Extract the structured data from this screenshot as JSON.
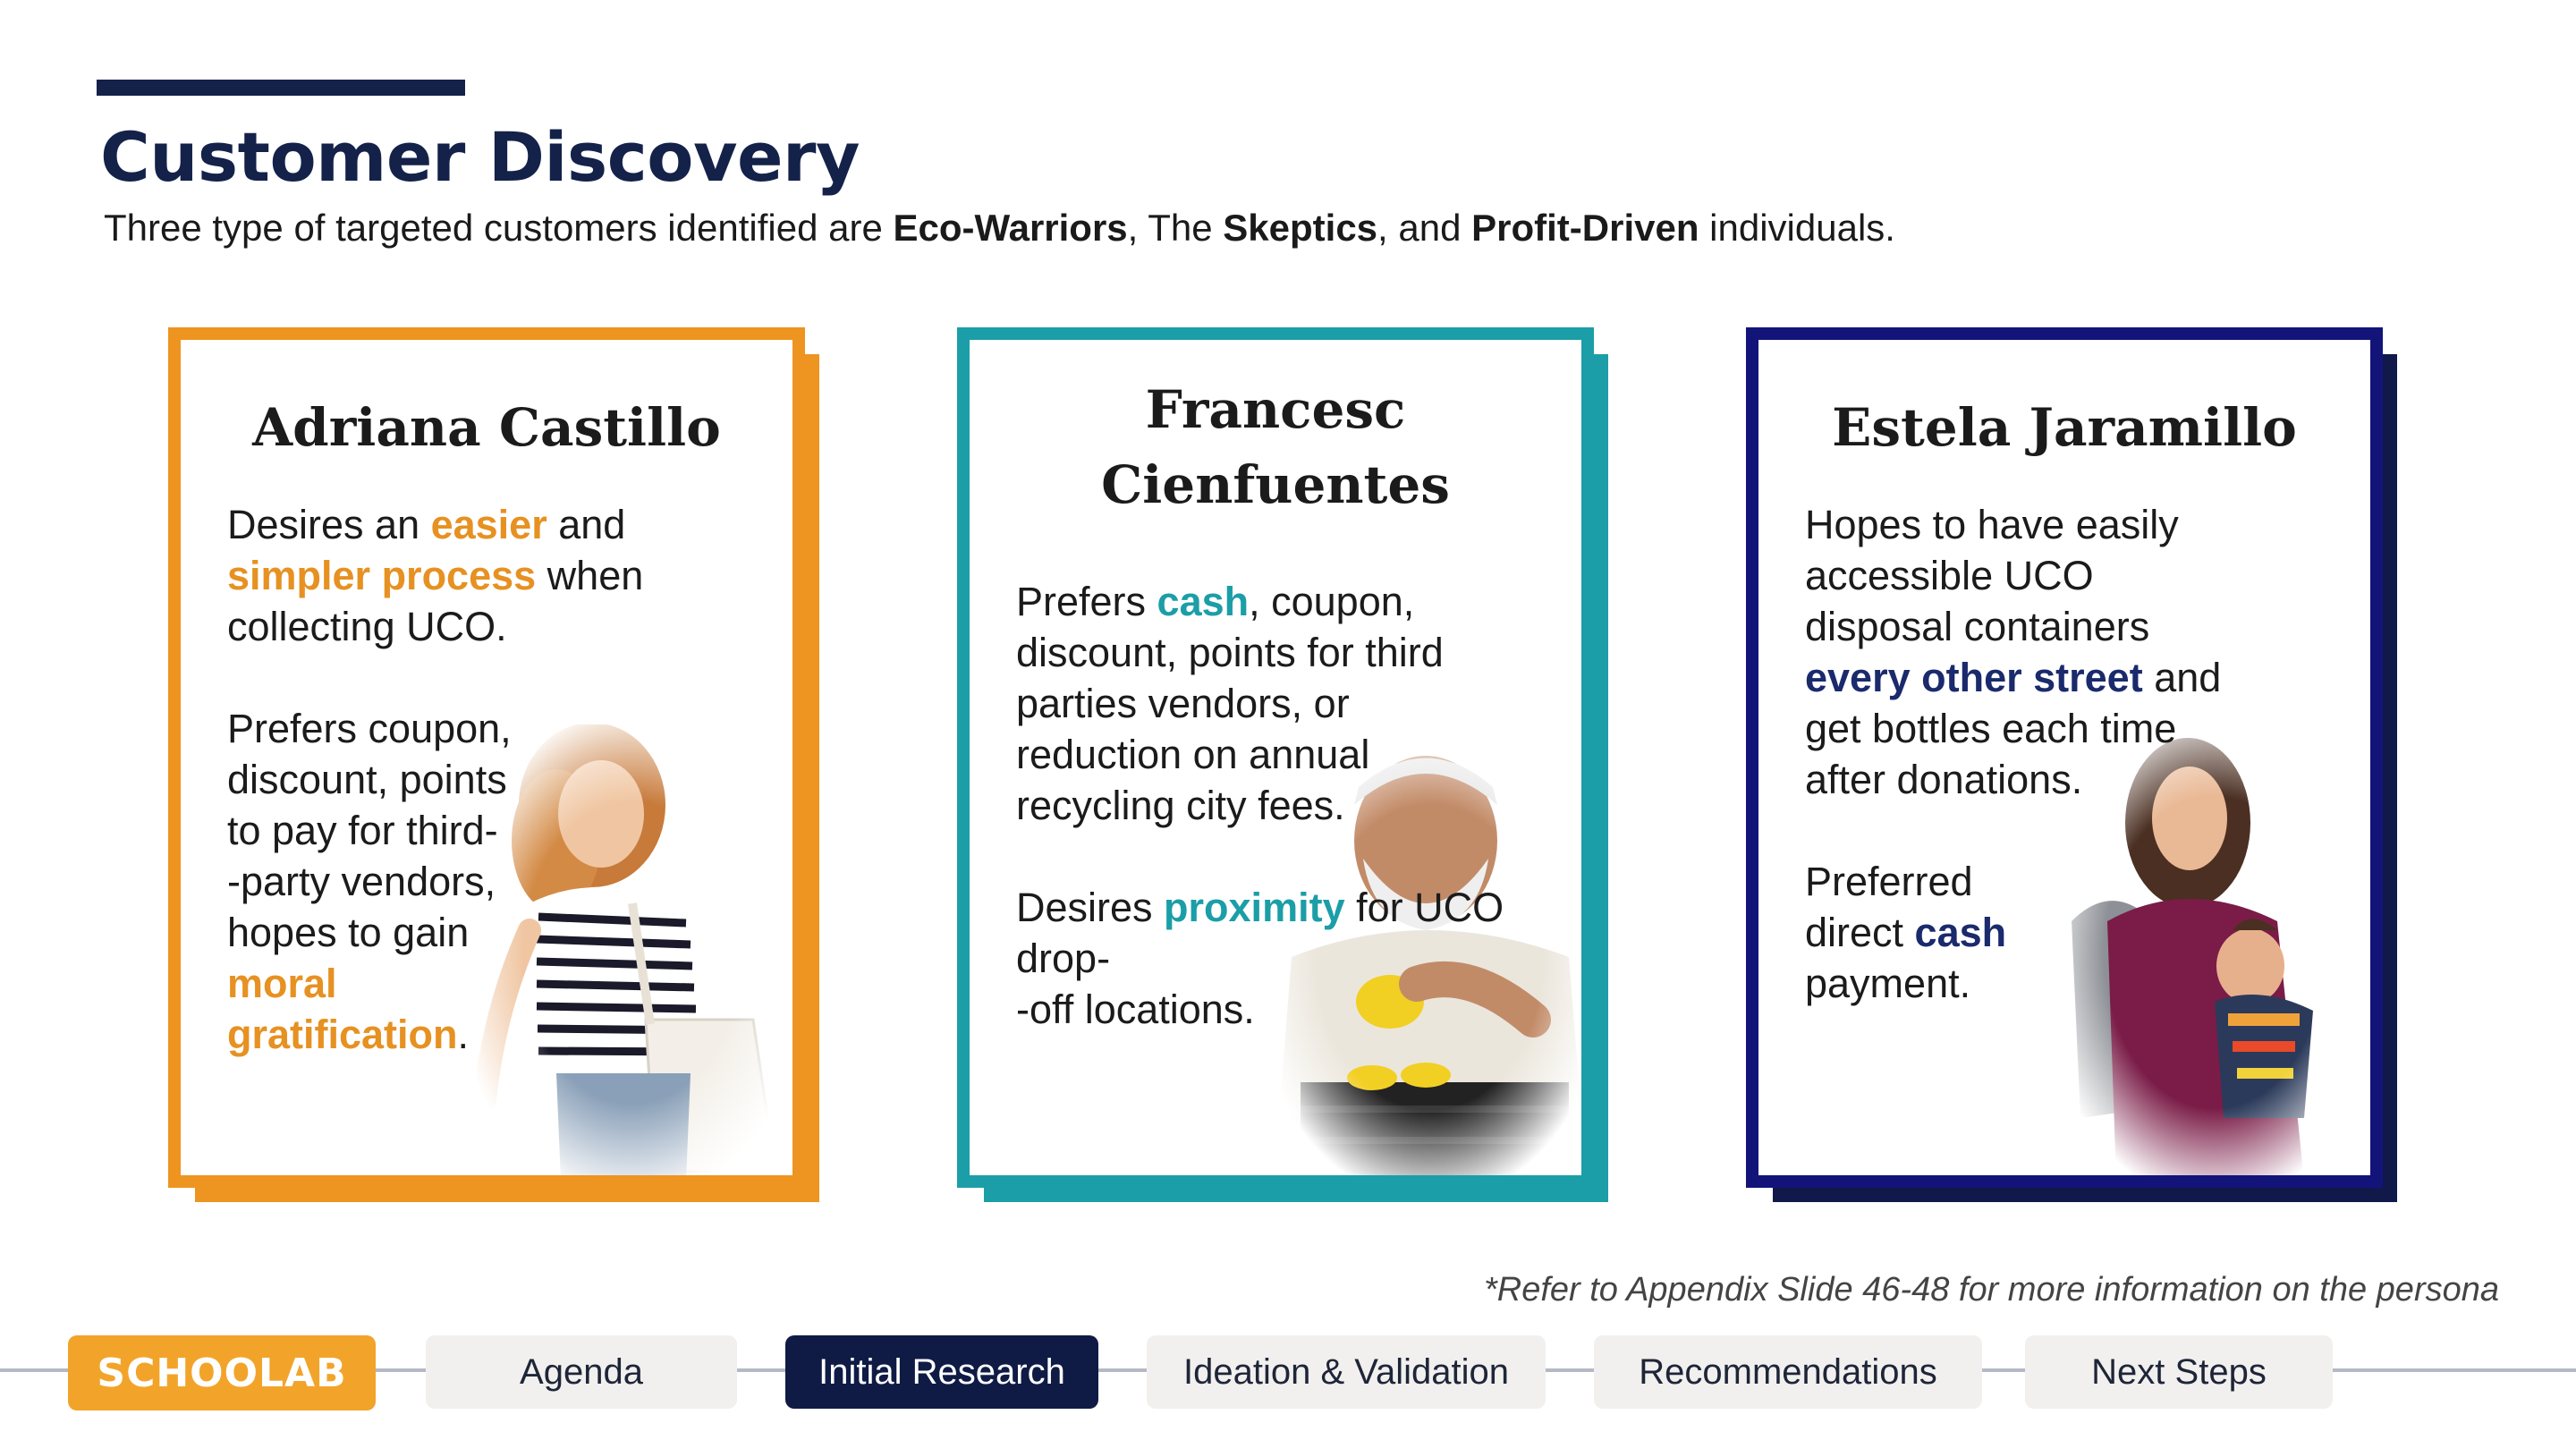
{
  "header": {
    "title": "Customer Discovery",
    "subtitle": {
      "t1": "Three type of targeted customers identified are ",
      "b1": "Eco-Warriors",
      "t2": ", The ",
      "b2": "Skeptics",
      "t3": ", and ",
      "b3": "Profit-Driven",
      "t4": " individuals."
    }
  },
  "personas": [
    {
      "name": "Adriana Castillo",
      "accent": "#ee9420",
      "p1": {
        "t1": "Desires an ",
        "h1": "easier",
        "t2": " and ",
        "h2": "simpler process",
        "t3": " when collecting UCO."
      },
      "p2": {
        "t1": "Prefers coupon, discount, points to pay for third-\n-party vendors, hopes to gain ",
        "h1": "moral gratification",
        "t2": "."
      },
      "photo": "young-woman-tote-bag-photo"
    },
    {
      "name": "Francesc Cienfuentes",
      "accent": "#1b9ea7",
      "p1": {
        "t1": "Prefers ",
        "h1": "cash",
        "t2": ", coupon, discount, points for third parties vendors, or reduction on annual recycling city fees."
      },
      "p2": {
        "t1": "Desires ",
        "h1": "proximity",
        "t2": " for UCO drop-\n-off locations."
      },
      "photo": "older-man-lemons-photo"
    },
    {
      "name": "Estela Jaramillo",
      "accent": "#12147a",
      "p1": {
        "t1": "Hopes to have easily accessible UCO disposal containers ",
        "h1": "every other street",
        "t2": " and get bottles each time after donations."
      },
      "p2": {
        "t1": "Preferred direct ",
        "h1": "cash",
        "t2": " payment."
      },
      "photo": "woman-with-baby-photo"
    }
  ],
  "footnote": "*Refer to Appendix Slide 46-48 for more information on the persona",
  "nav": {
    "logo": "SCHOOLAB",
    "items": [
      {
        "label": "Agenda"
      },
      {
        "label": "Initial Research",
        "active": true
      },
      {
        "label": "Ideation & Validation"
      },
      {
        "label": "Recommendations"
      },
      {
        "label": "Next Steps"
      }
    ]
  }
}
